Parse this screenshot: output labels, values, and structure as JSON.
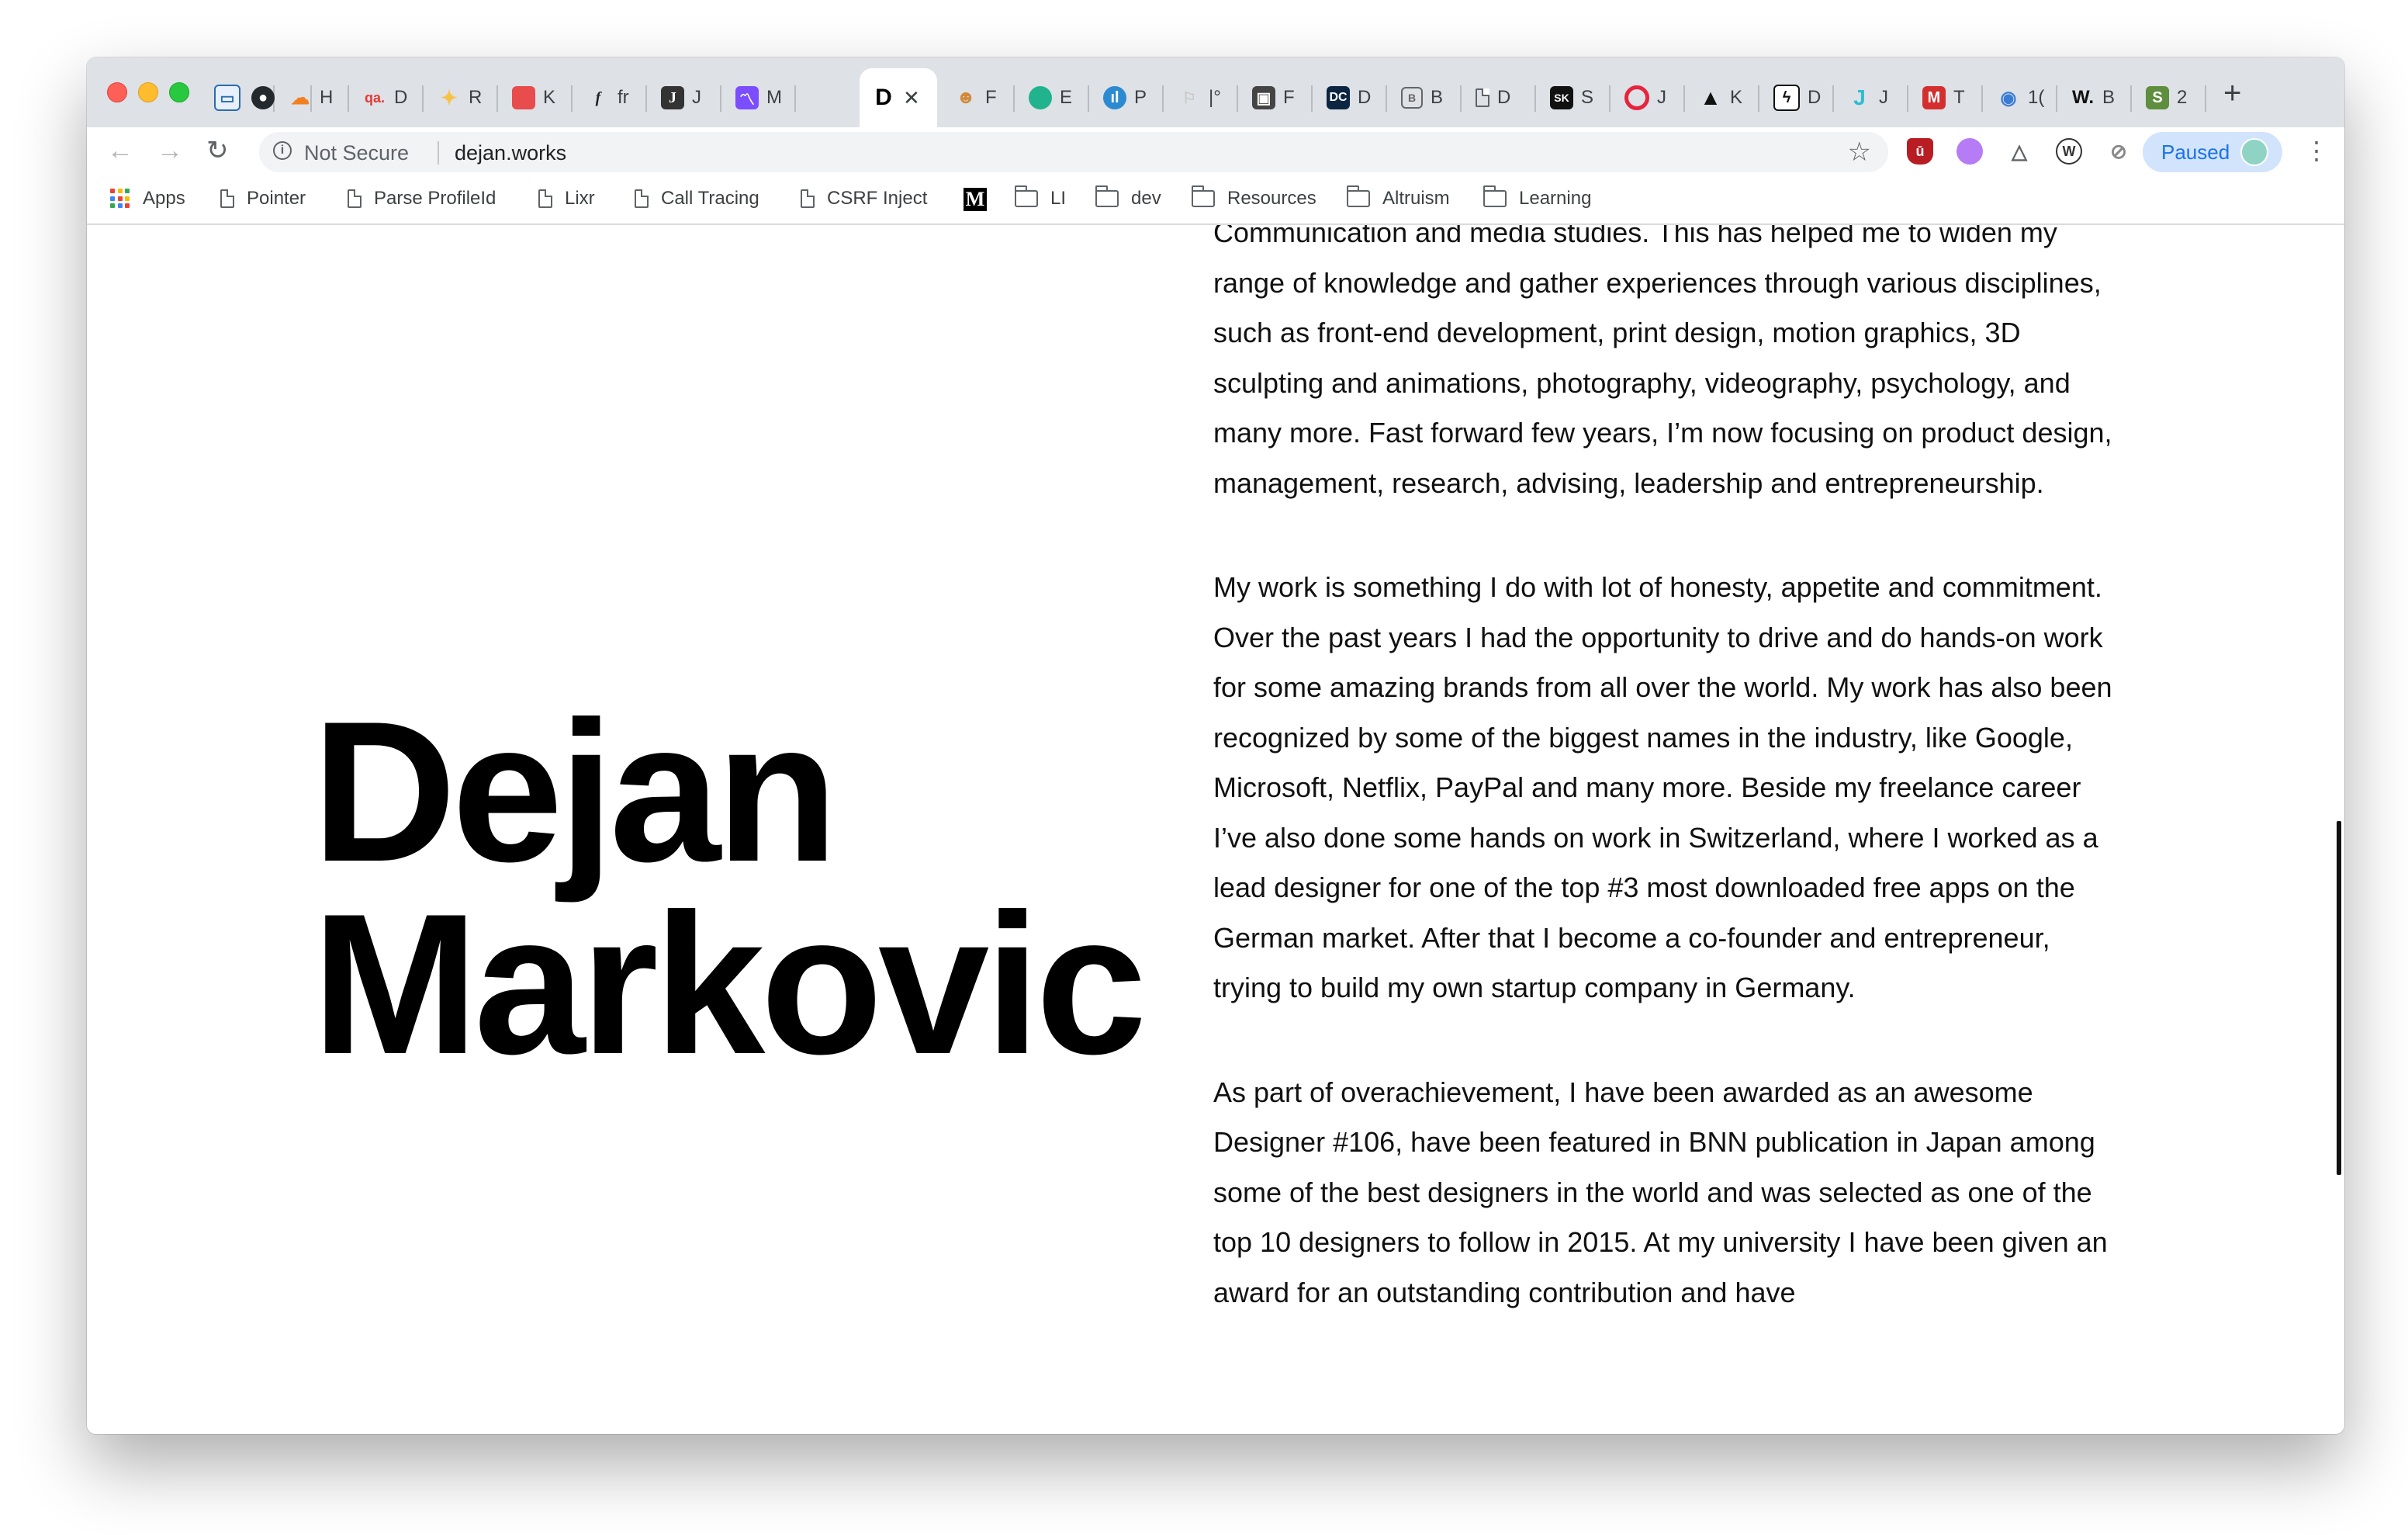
{
  "browser": {
    "tabs": [
      {
        "label": "",
        "icon": "inbox-icon"
      },
      {
        "label": "",
        "icon": "github-icon"
      },
      {
        "label": "H",
        "icon": "cloudflare-icon"
      },
      {
        "label": "D",
        "icon": "qa-icon"
      },
      {
        "label": "R",
        "icon": "sparkle-icon"
      },
      {
        "label": "K",
        "icon": "red-square-icon"
      },
      {
        "label": "fr",
        "icon": "function-icon"
      },
      {
        "label": "J",
        "icon": "j-icon"
      },
      {
        "label": "M",
        "icon": "chart-icon"
      },
      {
        "label": "",
        "icon": "d-logo-icon",
        "active": true
      },
      {
        "label": "F",
        "icon": "avatar-icon"
      },
      {
        "label": "E",
        "icon": "green-circle-icon"
      },
      {
        "label": "P",
        "icon": "blue-circle-icon"
      },
      {
        "label": "|°",
        "icon": "flag-icon"
      },
      {
        "label": "F",
        "icon": "photo-icon"
      },
      {
        "label": "D",
        "icon": "dc-icon"
      },
      {
        "label": "B",
        "icon": "box-icon"
      },
      {
        "label": "D",
        "icon": "page-icon"
      },
      {
        "label": "S",
        "icon": "sk-icon"
      },
      {
        "label": "J",
        "icon": "red-ring-icon"
      },
      {
        "label": "K",
        "icon": "triangle-icon"
      },
      {
        "label": "D",
        "icon": "bolt-icon"
      },
      {
        "label": "J",
        "icon": "teal-j-icon"
      },
      {
        "label": "T",
        "icon": "m-red-icon"
      },
      {
        "label": "1(",
        "icon": "eye-icon"
      },
      {
        "label": "B",
        "icon": "w-icon"
      },
      {
        "label": "2",
        "icon": "shopify-icon"
      }
    ],
    "active_tab_mark": "D",
    "close_glyph": "✕",
    "new_tab_glyph": "+",
    "address": {
      "security_label": "Not Secure",
      "url": "dejan.works"
    },
    "profile_label": "Paused",
    "bookmarks": [
      {
        "label": "Apps",
        "type": "apps"
      },
      {
        "label": "Pointer",
        "type": "page"
      },
      {
        "label": "Parse ProfileId",
        "type": "page"
      },
      {
        "label": "Lixr",
        "type": "page"
      },
      {
        "label": "Call Tracing",
        "type": "page"
      },
      {
        "label": "CSRF Inject",
        "type": "page"
      },
      {
        "label": "",
        "type": "medium"
      },
      {
        "label": "LI",
        "type": "folder"
      },
      {
        "label": "dev",
        "type": "folder"
      },
      {
        "label": "Resources",
        "type": "folder"
      },
      {
        "label": "Altruism",
        "type": "folder"
      },
      {
        "label": "Learning",
        "type": "folder"
      }
    ]
  },
  "page": {
    "name_line1": "Dejan",
    "name_line2": "Markovic",
    "paragraphs": [
      "Communication and media studies. This has helped me to widen my range of knowledge and gather experiences through various disciplines, such as front-end development, print design, motion graphics, 3D sculpting and animations, photography, videography, psychology, and many more. Fast forward few years, I’m now focusing on product design, management, research, advising, leadership and entrepreneurship.",
      "My work is something I do with lot of honesty, appetite and commitment. Over the past years I had the opportunity to drive and do hands-on work for some amazing brands from all over the world. My work has also been recognized by some of the biggest names in the industry, like Google, Microsoft, Netflix, PayPal and many more. Beside my freelance career I’ve also done some hands on work in Switzerland, where I worked as a lead designer for one of the top #3 most downloaded free apps on the German market. After that I become a co-founder and entrepreneur, trying to build my own startup company in Germany.",
      "As part of overachievement, I have been awarded as an awesome Designer #106, have been featured in BNN publication in Japan among some of the best designers in the world and was selected as one of the top 10 designers to follow in 2015. At my university I have been given an award for an outstanding contribution and have"
    ]
  }
}
